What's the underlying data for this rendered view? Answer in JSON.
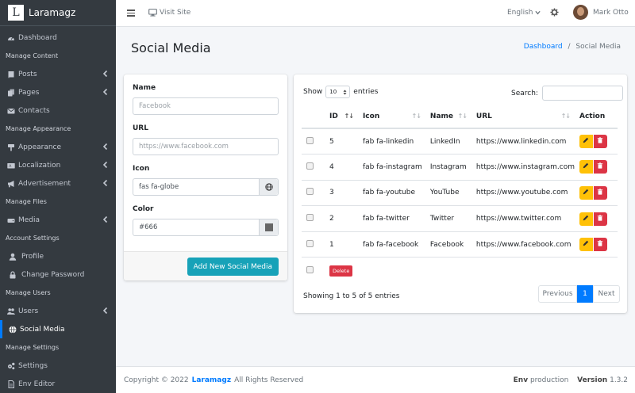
{
  "brand": {
    "logo_letter": "L",
    "name": "Laramagz"
  },
  "sidebar": [
    {
      "type": "item",
      "label": "Dashboard",
      "icon": "dashboard-icon",
      "arrow": false,
      "active": false
    },
    {
      "type": "header",
      "label": "Manage Content"
    },
    {
      "type": "item",
      "label": "Posts",
      "icon": "book-icon",
      "arrow": true,
      "active": false
    },
    {
      "type": "item",
      "label": "Pages",
      "icon": "copy-icon",
      "arrow": true,
      "active": false
    },
    {
      "type": "item",
      "label": "Contacts",
      "icon": "envelope-icon",
      "arrow": false,
      "active": false
    },
    {
      "type": "header",
      "label": "Manage Appearance"
    },
    {
      "type": "item",
      "label": "Appearance",
      "icon": "paint-brush-icon",
      "arrow": true,
      "active": false
    },
    {
      "type": "item",
      "label": "Localization",
      "icon": "language-icon",
      "arrow": true,
      "active": false
    },
    {
      "type": "item",
      "label": "Advertisement",
      "icon": "bullhorn-icon",
      "arrow": true,
      "active": false
    },
    {
      "type": "header",
      "label": "Manage Files"
    },
    {
      "type": "item",
      "label": "Media",
      "icon": "hdd-icon",
      "arrow": true,
      "active": false
    },
    {
      "type": "header",
      "label": "Account Settings"
    },
    {
      "type": "item",
      "label": "Profile",
      "icon": "user-icon",
      "arrow": false,
      "active": false,
      "sub": true
    },
    {
      "type": "item",
      "label": "Change Password",
      "icon": "lock-icon",
      "arrow": false,
      "active": false,
      "sub": true
    },
    {
      "type": "header",
      "label": "Manage Users"
    },
    {
      "type": "item",
      "label": "Users",
      "icon": "users-icon",
      "arrow": true,
      "active": false
    },
    {
      "type": "item",
      "label": "Social Media",
      "icon": "globe-icon",
      "arrow": false,
      "active": true
    },
    {
      "type": "header",
      "label": "Manage Settings"
    },
    {
      "type": "item",
      "label": "Settings",
      "icon": "cogs-icon",
      "arrow": false,
      "active": false
    },
    {
      "type": "item",
      "label": "Env Editor",
      "icon": "file-icon",
      "arrow": false,
      "active": false
    }
  ],
  "topbar": {
    "visit_label": "Visit Site",
    "language": "English",
    "user_name": "Mark Otto"
  },
  "page": {
    "title": "Social Media"
  },
  "breadcrumb": {
    "home": "Dashboard",
    "separator": "/",
    "current": "Social Media"
  },
  "form": {
    "name_label": "Name",
    "name_placeholder": "Facebook",
    "url_label": "URL",
    "url_placeholder": "https://www.facebook.com",
    "icon_label": "Icon",
    "icon_value": "fas fa-globe",
    "color_label": "Color",
    "color_value": "#666",
    "submit_label": "Add New Social Media"
  },
  "table": {
    "show_label": "Show",
    "entries_value": "10",
    "entries_label": "entries",
    "search_label": "Search:",
    "columns": [
      "ID",
      "Icon",
      "Name",
      "URL",
      "Action"
    ],
    "rows": [
      {
        "id": "5",
        "icon": "fab fa-linkedin",
        "name": "LinkedIn",
        "url": "https://www.linkedin.com"
      },
      {
        "id": "4",
        "icon": "fab fa-instagram",
        "name": "Instagram",
        "url": "https://www.instagram.com"
      },
      {
        "id": "3",
        "icon": "fab fa-youtube",
        "name": "YouTube",
        "url": "https://www.youtube.com"
      },
      {
        "id": "2",
        "icon": "fab fa-twitter",
        "name": "Twitter",
        "url": "https://www.twitter.com"
      },
      {
        "id": "1",
        "icon": "fab fa-facebook",
        "name": "Facebook",
        "url": "https://www.facebook.com"
      }
    ],
    "bulk_delete_label": "Delete",
    "info": "Showing 1 to 5 of 5 entries",
    "pagination": {
      "previous": "Previous",
      "current": "1",
      "next": "Next"
    }
  },
  "footer": {
    "copyright": "Copyright © 2022",
    "brand": "Laramagz",
    "rights": "All Rights Reserved",
    "env_label": "Env",
    "env_value": "production",
    "version_label": "Version",
    "version_value": "1.3.2"
  },
  "colors": {
    "sidebar": "#343a40",
    "accent": "#007bff",
    "info": "#17a2b8",
    "warning": "#ffc107",
    "danger": "#dc3545"
  }
}
